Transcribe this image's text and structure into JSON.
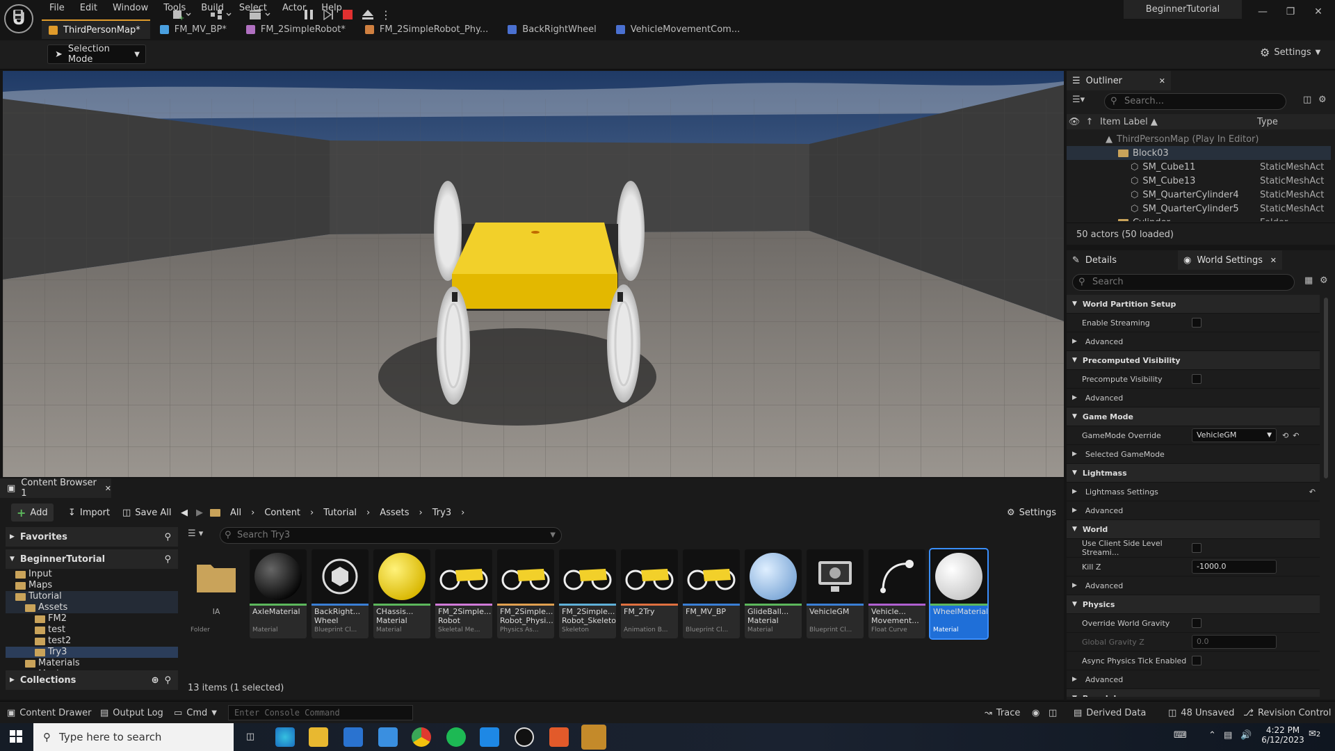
{
  "menu": {
    "items": [
      "File",
      "Edit",
      "Window",
      "Tools",
      "Build",
      "Select",
      "Actor",
      "Help"
    ],
    "project": "BeginnerTutorial"
  },
  "tabs": [
    {
      "label": "ThirdPersonMap*",
      "color": "#e09b2b"
    },
    {
      "label": "FM_MV_BP*",
      "color": "#4aa0e0"
    },
    {
      "label": "FM_2SimpleRobot*",
      "color": "#b070c0"
    },
    {
      "label": "FM_2SimpleRobot_Phy...",
      "color": "#d08040"
    },
    {
      "label": "BackRightWheel",
      "color": "#4a70d0"
    },
    {
      "label": "VehicleMovementCom...",
      "color": "#4a70d0"
    }
  ],
  "toolbar": {
    "selection_mode": "Selection Mode",
    "settings": "Settings"
  },
  "content_browser": {
    "tab": "Content Browser 1",
    "add": "Add",
    "import": "Import",
    "save_all": "Save All",
    "breadcrumb": [
      "All",
      "Content",
      "Tutorial",
      "Assets",
      "Try3"
    ],
    "settings": "Settings",
    "favorites": "Favorites",
    "project": "BeginnerTutorial",
    "tree": [
      {
        "label": "Input",
        "indent": 1
      },
      {
        "label": "Maps",
        "indent": 1
      },
      {
        "label": "Tutorial",
        "indent": 1
      },
      {
        "label": "Assets",
        "indent": 2
      },
      {
        "label": "FM2",
        "indent": 3
      },
      {
        "label": "test",
        "indent": 3
      },
      {
        "label": "test2",
        "indent": 3
      },
      {
        "label": "Try3",
        "indent": 3
      },
      {
        "label": "Materials",
        "indent": 2
      },
      {
        "label": "Meshes",
        "indent": 2
      }
    ],
    "collections": "Collections",
    "search_placeholder": "Search Try3",
    "item_count": "13 items (1 selected)",
    "assets": [
      {
        "name": "IA",
        "type": "Folder",
        "kind": "folder",
        "bar": ""
      },
      {
        "name": "AxleMaterial",
        "type": "Material",
        "kind": "blacksphere",
        "bar": "#5cb85c"
      },
      {
        "name": "BackRight... Wheel",
        "type": "Blueprint Cl...",
        "kind": "bp",
        "bar": "#3a7fd5"
      },
      {
        "name": "CHassis... Material",
        "type": "Material",
        "kind": "yellowsphere",
        "bar": "#5cb85c"
      },
      {
        "name": "FM_2Simple... Robot",
        "type": "Skeletal Me...",
        "kind": "robot",
        "bar": "#d07ad8"
      },
      {
        "name": "FM_2Simple... Robot_Physi...",
        "type": "Physics As...",
        "kind": "robot",
        "bar": "#e0a050"
      },
      {
        "name": "FM_2Simple... Robot_Skeleton",
        "type": "Skeleton",
        "kind": "robot",
        "bar": "#5fb0d8"
      },
      {
        "name": "FM_2Try",
        "type": "Animation B...",
        "kind": "robot",
        "bar": "#e07040"
      },
      {
        "name": "FM_MV_BP",
        "type": "Blueprint Cl...",
        "kind": "robot",
        "bar": "#3a7fd5"
      },
      {
        "name": "GlideBall... Material",
        "type": "Material",
        "kind": "bluesphere",
        "bar": "#5cb85c"
      },
      {
        "name": "VehicleGM",
        "type": "Blueprint Cl...",
        "kind": "gm",
        "bar": "#3a7fd5"
      },
      {
        "name": "Vehicle... Movement...",
        "type": "Float Curve",
        "kind": "curve",
        "bar": "#b060d0"
      },
      {
        "name": "WheelMaterial",
        "type": "Material",
        "kind": "whitesphere",
        "bar": "#5cb85c"
      }
    ]
  },
  "outliner": {
    "title": "Outliner",
    "search_placeholder": "Search...",
    "col_label": "Item Label ▲",
    "col_type": "Type",
    "rows": [
      {
        "label": "ThirdPersonMap (Play In Editor)",
        "type": "",
        "indent": 0,
        "icon": "map"
      },
      {
        "label": "Block03",
        "type": "",
        "indent": 1,
        "icon": "folder"
      },
      {
        "label": "SM_Cube11",
        "type": "StaticMeshAct",
        "indent": 2,
        "icon": "mesh"
      },
      {
        "label": "SM_Cube13",
        "type": "StaticMeshAct",
        "indent": 2,
        "icon": "mesh"
      },
      {
        "label": "SM_QuarterCylinder4",
        "type": "StaticMeshAct",
        "indent": 2,
        "icon": "mesh"
      },
      {
        "label": "SM_QuarterCylinder5",
        "type": "StaticMeshAct",
        "indent": 2,
        "icon": "mesh"
      },
      {
        "label": "Cylinder",
        "type": "Folder",
        "indent": 1,
        "icon": "folder"
      }
    ],
    "footer": "50 actors (50 loaded)"
  },
  "details": {
    "tab1": "Details",
    "tab2": "World Settings",
    "search_placeholder": "Search",
    "rows": [
      {
        "kind": "cat",
        "label": "World Partition Setup"
      },
      {
        "kind": "prop",
        "label": "Enable Streaming",
        "control": "check",
        "value": ""
      },
      {
        "kind": "sub",
        "label": "Advanced"
      },
      {
        "kind": "cat",
        "label": "Precomputed Visibility"
      },
      {
        "kind": "prop",
        "label": "Precompute Visibility",
        "control": "check",
        "value": ""
      },
      {
        "kind": "sub",
        "label": "Advanced"
      },
      {
        "kind": "cat",
        "label": "Game Mode"
      },
      {
        "kind": "prop",
        "label": "GameMode Override",
        "control": "select",
        "value": "VehicleGM"
      },
      {
        "kind": "sub",
        "label": "Selected GameMode"
      },
      {
        "kind": "cat",
        "label": "Lightmass"
      },
      {
        "kind": "sub",
        "label": "Lightmass Settings",
        "control": "reset"
      },
      {
        "kind": "sub",
        "label": "Advanced"
      },
      {
        "kind": "cat",
        "label": "World"
      },
      {
        "kind": "prop",
        "label": "Use Client Side Level Streami...",
        "control": "check",
        "value": ""
      },
      {
        "kind": "prop",
        "label": "Kill Z",
        "control": "num",
        "value": "-1000.0"
      },
      {
        "kind": "sub",
        "label": "Advanced"
      },
      {
        "kind": "cat",
        "label": "Physics"
      },
      {
        "kind": "prop",
        "label": "Override World Gravity",
        "control": "check",
        "value": ""
      },
      {
        "kind": "prop",
        "label": "Global Gravity Z",
        "control": "numdim",
        "value": "0.0"
      },
      {
        "kind": "prop",
        "label": "Async Physics Tick Enabled",
        "control": "check",
        "value": ""
      },
      {
        "kind": "sub",
        "label": "Advanced"
      },
      {
        "kind": "cat",
        "label": "Broadphase"
      }
    ]
  },
  "statusbar": {
    "content_drawer": "Content Drawer",
    "output_log": "Output Log",
    "cmd": "Cmd",
    "console_placeholder": "Enter Console Command",
    "trace": "Trace",
    "derived_data": "Derived Data",
    "unsaved": "48 Unsaved",
    "revision_control": "Revision Control"
  },
  "taskbar": {
    "search_placeholder": "Type here to search",
    "time": "4:22 PM",
    "date": "6/12/2023",
    "notifications": "2"
  }
}
